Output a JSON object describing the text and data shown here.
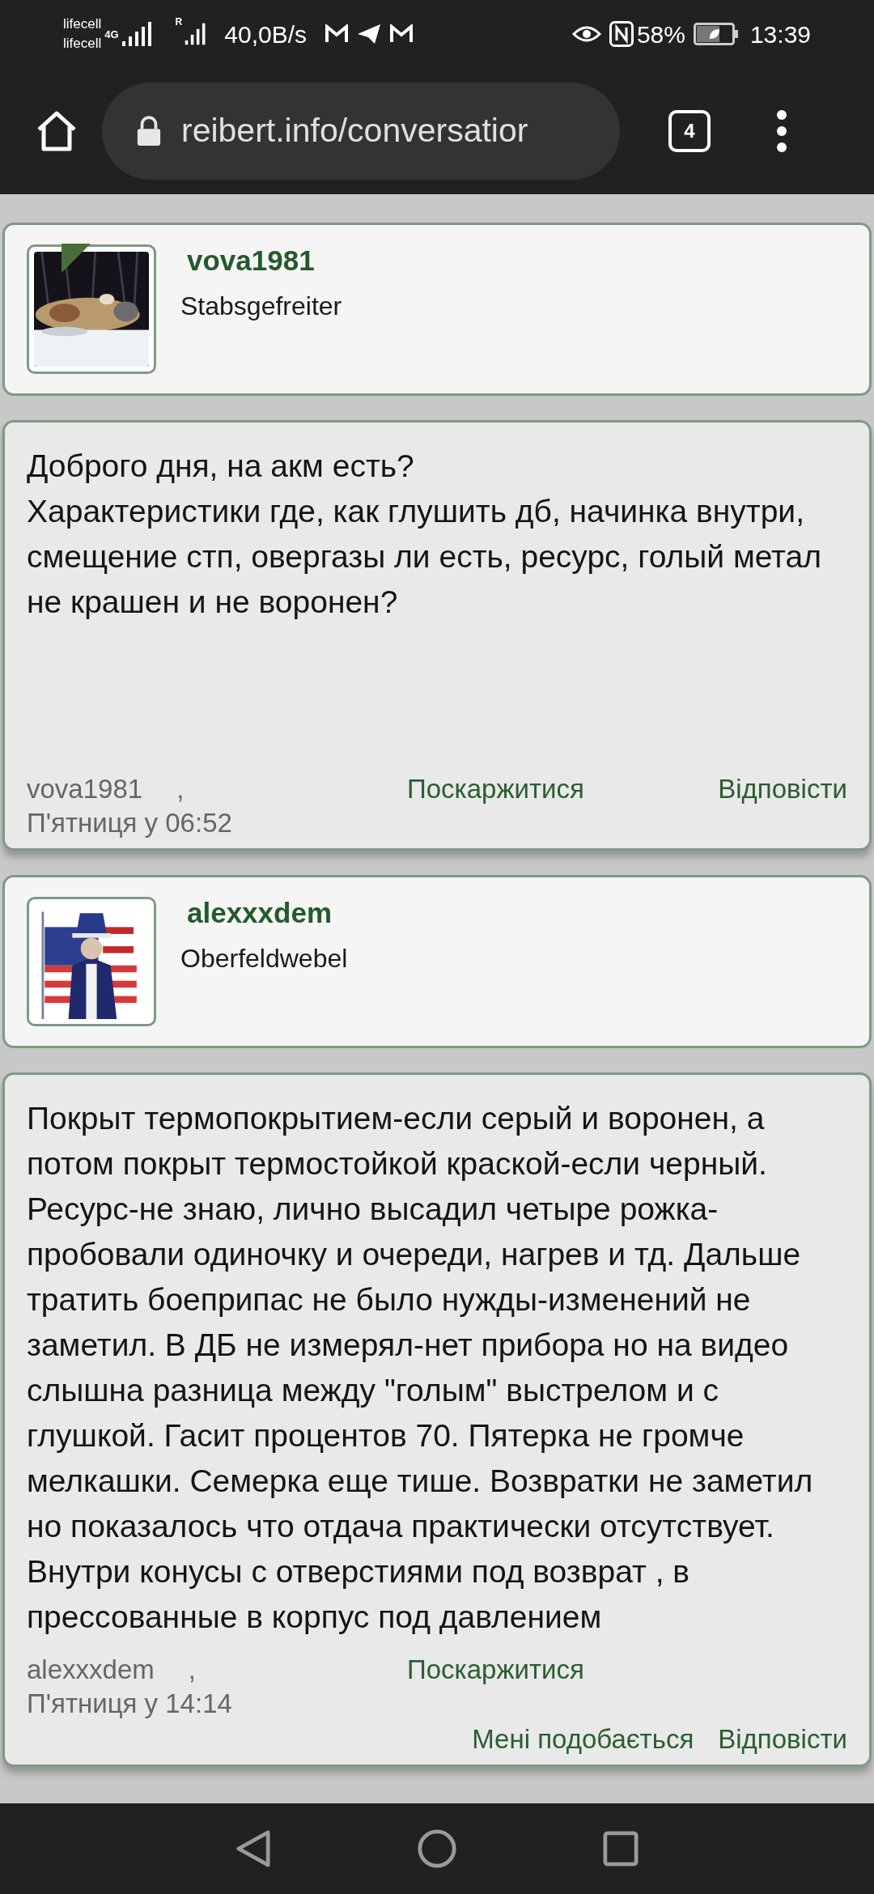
{
  "status_bar": {
    "carrier_1": "lifecell",
    "carrier_2": "lifecell",
    "network": "4G",
    "roaming": "R",
    "speed": "40,0B/s",
    "battery": "58%",
    "time": "13:39"
  },
  "browser": {
    "url": "reibert.info/conversatior",
    "tab_count": "4"
  },
  "posts": [
    {
      "author": {
        "name": "vova1981",
        "rank": "Stabsgefreiter",
        "online": true
      },
      "lines": [
        "Доброго дня, на акм есть?",
        "Характеристики где, как глушить дб, начинка внутри, смещение стп, овергазы ли есть, ресурс, голый метал не крашен и не воронен?"
      ],
      "footer": {
        "author": "vova1981",
        "separator": ",",
        "date": "П'ятниця у 06:52",
        "report": "Поскаржитися",
        "reply": "Відповісти"
      }
    },
    {
      "author": {
        "name": "alexxxdem",
        "rank": "Oberfeldwebel",
        "online": false
      },
      "lines": [
        "Покрыт термопокрытием-если серый и воронен, а потом покрыт термостойкой краской-если черный. Ресурс-не знаю, лично высадил четыре рожка-пробовали одиночку и очереди, нагрев и тд. Дальше тратить боеприпас не было нужды-изменений не заметил. В ДБ не измерял-нет прибора но на видео слышна разница между \"голым\" выстрелом и с глушкой. Гасит процентов 70. Пятерка не громче мелкашки. Семерка еще тише. Возвратки не заметил но показалось что отдача практически отсутствует. Внутри конусы с отверстиями под возврат , в прессованные в корпус под давлением"
      ],
      "footer": {
        "author": "alexxxdem",
        "separator": ",",
        "date": "П'ятниця у 14:14",
        "report": "Поскаржитися",
        "like": "Мені подобається",
        "reply": "Відповісти"
      }
    }
  ]
}
